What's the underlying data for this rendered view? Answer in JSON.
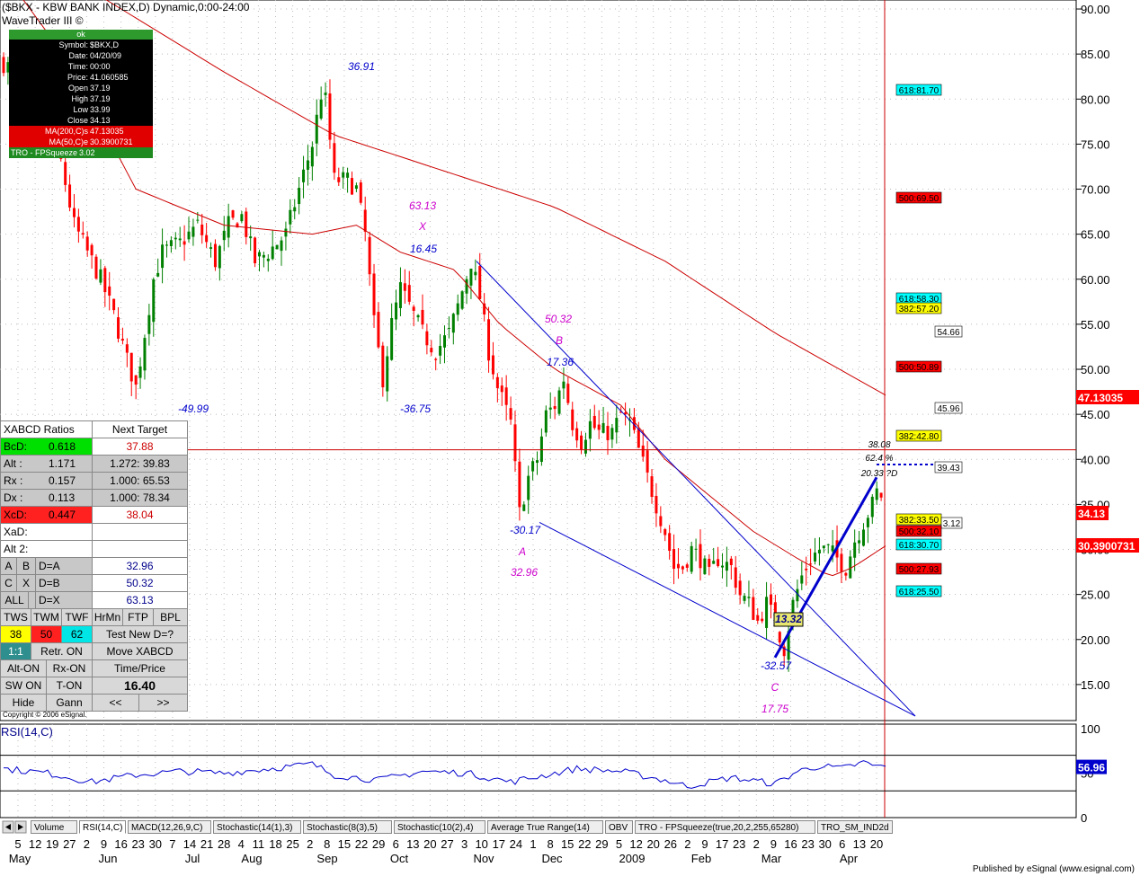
{
  "header": {
    "title": "($BKX - KBW BANK INDEX,D) Dynamic,0:00-24:00",
    "subtitle": "WaveTrader III ©"
  },
  "infobox": {
    "status": "ok",
    "rows": [
      {
        "k": "Symbol:",
        "v": "$BKX,D"
      },
      {
        "k": "Date:",
        "v": "04/20/09"
      },
      {
        "k": "Time:",
        "v": "00:00"
      },
      {
        "k": "Price:",
        "v": "41.060585"
      },
      {
        "k": "Open",
        "v": "37.19"
      },
      {
        "k": "High",
        "v": "37.19"
      },
      {
        "k": "Low",
        "v": "33.99"
      },
      {
        "k": "Close",
        "v": "34.13"
      }
    ],
    "ma200": {
      "k": "MA(200,C)s",
      "v": "47.13035"
    },
    "ma50": {
      "k": "MA(50,C)e",
      "v": "30.3900731"
    },
    "tro": {
      "k": "TRO - FPSqueeze",
      "v": "3.02"
    }
  },
  "panel": {
    "title_left": "XABCD Ratios",
    "title_right": "Next Target",
    "rows": [
      {
        "k": "BcD:",
        "k2": "0.618",
        "v": "37.88"
      },
      {
        "k": "Alt   :",
        "k2": "1.171",
        "v": "1.272: 39.83"
      },
      {
        "k": "Rx    :",
        "k2": "0.157",
        "v": "1.000: 65.53"
      },
      {
        "k": "Dx    :",
        "k2": "0.113",
        "v": "1.000: 78.34"
      },
      {
        "k": "XcD:",
        "k2": "0.447",
        "v": "38.04"
      },
      {
        "k": "XaD:",
        "k2": "",
        "v": ""
      },
      {
        "k": "Alt 2:",
        "k2": "",
        "v": ""
      }
    ],
    "pairs": [
      {
        "a": "A",
        "b": "B",
        "c": "D=A",
        "v": "32.96"
      },
      {
        "a": "C",
        "b": "X",
        "c": "D=B",
        "v": "50.32"
      },
      {
        "a": "ALL",
        "b": "",
        "c": "D=X",
        "v": "63.13"
      }
    ],
    "tf": [
      "TWS",
      "TWM",
      "TWF",
      "HrMn",
      "FTP",
      "BPL"
    ],
    "tf_vals": [
      "38",
      "50",
      "62"
    ],
    "test_label": "Test New D=?",
    "btn_11": "1:1",
    "btn_retr": "Retr. ON",
    "btn_move": "Move XABCD",
    "btn_alt": "Alt-ON",
    "btn_rx": "Rx-ON",
    "btn_tp": "Time/Price",
    "btn_sw": "SW ON",
    "btn_t": "T-ON",
    "value": "16.40",
    "btn_hide": "Hide",
    "btn_gann": "Gann",
    "btn_prev": "<<",
    "btn_next": ">>"
  },
  "copyright": "Copyright © 2006 eSignal.",
  "rsi_label": "RSI(14,C)",
  "tabs": [
    "Volume",
    "RSI(14,C)",
    "MACD(12,26,9,C)",
    "Stochastic(14(1),3)",
    "Stochastic(8(3),5)",
    "Stochastic(10(2),4)",
    "Average True Range(14)",
    "OBV",
    "TRO - FPSqueeze(true,20,2,255,65280)",
    "TRO_SM_IND2d"
  ],
  "footer": "Published by eSignal (www.esignal.com)",
  "colors": {
    "up": "#008000",
    "down": "#ff0000",
    "ma": "#cc0000",
    "channel": "#0000cc",
    "pattern_magenta": "#cc00cc",
    "pattern_blue": "#0000cc"
  },
  "chart_data": {
    "type": "candlestick",
    "ylim": [
      11,
      91
    ],
    "y_ticks": [
      "90.00",
      "85.00",
      "80.00",
      "75.00",
      "70.00",
      "65.00",
      "60.00",
      "55.00",
      "50.00",
      "45.00",
      "40.00",
      "35.00",
      "30.00",
      "25.00",
      "20.00",
      "15.00"
    ],
    "x_day_ticks": [
      "5",
      "12",
      "19",
      "27",
      "2",
      "9",
      "16",
      "23",
      "30",
      "7",
      "14",
      "21",
      "28",
      "4",
      "11",
      "18",
      "25",
      "2",
      "8",
      "15",
      "22",
      "29",
      "6",
      "13",
      "20",
      "27",
      "3",
      "10",
      "17",
      "24",
      "1",
      "8",
      "15",
      "22",
      "29",
      "5",
      "12",
      "20",
      "26",
      "2",
      "9",
      "17",
      "23",
      "2",
      "9",
      "16",
      "23",
      "30",
      "6",
      "13",
      "20"
    ],
    "x_month_ticks": [
      "May",
      "Jun",
      "Jul",
      "Aug",
      "Sep",
      "Oct",
      "Nov",
      "Dec",
      "2009",
      "Feb",
      "Mar",
      "Apr"
    ],
    "close_anchors": [
      [
        0,
        84
      ],
      [
        10,
        82
      ],
      [
        20,
        78
      ],
      [
        26,
        73
      ],
      [
        32,
        66
      ],
      [
        38,
        63
      ],
      [
        44,
        60
      ],
      [
        50,
        56
      ],
      [
        56,
        51
      ],
      [
        60,
        48
      ],
      [
        64,
        54
      ],
      [
        68,
        60
      ],
      [
        72,
        63
      ],
      [
        80,
        64
      ],
      [
        88,
        66
      ],
      [
        96,
        62
      ],
      [
        102,
        66
      ],
      [
        108,
        67
      ],
      [
        114,
        62
      ],
      [
        120,
        63
      ],
      [
        128,
        65
      ],
      [
        134,
        70
      ],
      [
        140,
        75
      ],
      [
        145,
        82
      ],
      [
        150,
        71
      ],
      [
        156,
        71
      ],
      [
        160,
        70
      ],
      [
        164,
        65
      ],
      [
        168,
        55
      ],
      [
        172,
        49
      ],
      [
        176,
        55
      ],
      [
        180,
        59
      ],
      [
        184,
        57
      ],
      [
        190,
        54
      ],
      [
        196,
        52
      ],
      [
        202,
        54
      ],
      [
        206,
        57
      ],
      [
        212,
        62
      ],
      [
        216,
        58
      ],
      [
        220,
        52
      ],
      [
        224,
        48
      ],
      [
        230,
        44
      ],
      [
        234,
        34
      ],
      [
        238,
        38
      ],
      [
        242,
        40
      ],
      [
        246,
        45
      ],
      [
        250,
        46
      ],
      [
        254,
        49
      ],
      [
        258,
        44
      ],
      [
        262,
        42
      ],
      [
        266,
        44
      ],
      [
        270,
        43
      ],
      [
        276,
        43
      ],
      [
        280,
        45
      ],
      [
        284,
        44
      ],
      [
        288,
        41
      ],
      [
        292,
        38
      ],
      [
        296,
        35
      ],
      [
        300,
        32
      ],
      [
        304,
        28
      ],
      [
        308,
        28
      ],
      [
        312,
        30
      ],
      [
        316,
        29
      ],
      [
        320,
        27
      ],
      [
        324,
        29
      ],
      [
        330,
        28
      ],
      [
        334,
        25
      ],
      [
        338,
        24
      ],
      [
        342,
        22
      ],
      [
        346,
        24
      ],
      [
        350,
        22
      ],
      [
        354,
        19
      ],
      [
        358,
        24
      ],
      [
        362,
        27
      ],
      [
        366,
        29
      ],
      [
        370,
        30
      ],
      [
        374,
        30
      ],
      [
        378,
        29
      ],
      [
        382,
        28
      ],
      [
        386,
        31
      ],
      [
        390,
        33
      ],
      [
        394,
        35
      ],
      [
        397,
        37
      ],
      [
        400,
        34
      ]
    ],
    "ma200_anchors": [
      [
        0,
        96
      ],
      [
        40,
        92
      ],
      [
        100,
        83
      ],
      [
        150,
        76
      ],
      [
        200,
        72
      ],
      [
        250,
        68
      ],
      [
        300,
        62
      ],
      [
        350,
        54
      ],
      [
        400,
        47.13
      ]
    ],
    "ma50_anchors": [
      [
        0,
        94
      ],
      [
        30,
        84
      ],
      [
        60,
        70
      ],
      [
        100,
        66
      ],
      [
        140,
        65
      ],
      [
        160,
        66
      ],
      [
        180,
        63
      ],
      [
        205,
        61
      ],
      [
        225,
        55
      ],
      [
        250,
        50
      ],
      [
        280,
        46
      ],
      [
        300,
        40
      ],
      [
        320,
        36
      ],
      [
        340,
        32
      ],
      [
        360,
        29
      ],
      [
        375,
        27
      ],
      [
        385,
        28
      ],
      [
        400,
        30.39
      ]
    ],
    "pattern_labels": [
      {
        "t": "36.91",
        "kind": "blue"
      },
      {
        "t": "-49.99",
        "kind": "blue"
      },
      {
        "t": "63.13",
        "kind": "magenta"
      },
      {
        "t": "X",
        "kind": "magenta"
      },
      {
        "t": "16.45",
        "kind": "blue"
      },
      {
        "t": "-36.75",
        "kind": "blue"
      },
      {
        "t": "50.32",
        "kind": "magenta"
      },
      {
        "t": "B",
        "kind": "magenta"
      },
      {
        "t": "17.36",
        "kind": "blue"
      },
      {
        "t": "-30.17",
        "kind": "blue"
      },
      {
        "t": "A",
        "kind": "magenta"
      },
      {
        "t": "32.96",
        "kind": "magenta"
      },
      {
        "t": "-32.57",
        "kind": "blue"
      },
      {
        "t": "C",
        "kind": "magenta"
      },
      {
        "t": "17.75",
        "kind": "magenta"
      },
      {
        "t": "13.32",
        "kind": "box"
      },
      {
        "t": "38.08",
        "kind": "black"
      },
      {
        "t": "62.4 %",
        "kind": "black"
      },
      {
        "t": "20.33 ?D",
        "kind": "black"
      }
    ],
    "target_boxes": [
      {
        "t": "618:81.70",
        "bg": "#00ffff"
      },
      {
        "t": "500:69.50",
        "bg": "#ff0000"
      },
      {
        "t": "618:58.30",
        "bg": "#00ffff"
      },
      {
        "t": "382:57.20",
        "bg": "#ffff00"
      },
      {
        "t": "54.66",
        "bg": "#ffffff"
      },
      {
        "t": "500:50.89",
        "bg": "#ff0000"
      },
      {
        "t": "45.96",
        "bg": "#ffffff"
      },
      {
        "t": "382:42.80",
        "bg": "#ffff00"
      },
      {
        "t": "39.43",
        "bg": "#ffffff"
      },
      {
        "t": "382:33.50",
        "bg": "#ffff00"
      },
      {
        "t": "3.12",
        "bg": "#ffffff"
      },
      {
        "t": "500:32.10",
        "bg": "#ff0000"
      },
      {
        "t": "618:30.70",
        "bg": "#00ffff"
      },
      {
        "t": "500:27.93",
        "bg": "#ff0000"
      },
      {
        "t": "618:25.50",
        "bg": "#00ffff"
      }
    ],
    "price_tags": [
      {
        "t": "47.13035",
        "bg": "#ff0000"
      },
      {
        "t": "34.13",
        "bg": "#ff0000"
      },
      {
        "t": "30.3900731",
        "bg": "#ff0000"
      }
    ],
    "rsi": {
      "ylim": [
        0,
        105
      ],
      "y_ticks": [
        "100",
        "50",
        "0"
      ],
      "levels": [
        70,
        30
      ],
      "last": "56.96",
      "anchors": [
        [
          0,
          55
        ],
        [
          20,
          50
        ],
        [
          40,
          40
        ],
        [
          60,
          48
        ],
        [
          80,
          52
        ],
        [
          100,
          50
        ],
        [
          120,
          55
        ],
        [
          140,
          60
        ],
        [
          150,
          48
        ],
        [
          170,
          42
        ],
        [
          190,
          52
        ],
        [
          210,
          50
        ],
        [
          230,
          40
        ],
        [
          240,
          45
        ],
        [
          260,
          55
        ],
        [
          280,
          52
        ],
        [
          300,
          42
        ],
        [
          310,
          35
        ],
        [
          330,
          45
        ],
        [
          350,
          38
        ],
        [
          360,
          52
        ],
        [
          370,
          58
        ],
        [
          380,
          55
        ],
        [
          390,
          62
        ],
        [
          395,
          58
        ],
        [
          400,
          56.96
        ]
      ]
    }
  }
}
